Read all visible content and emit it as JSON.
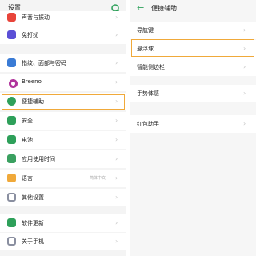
{
  "left": {
    "title": "设置",
    "items": [
      {
        "label": "声音与振动",
        "icon": "speaker-icon",
        "color": "#e8443a"
      },
      {
        "label": "免打扰",
        "icon": "moon-icon",
        "color": "#5b4fd6"
      },
      {
        "label": "指纹、面部与密码",
        "icon": "fingerprint-icon",
        "color": "#3a7bd5"
      },
      {
        "label": "Breeno",
        "icon": "breeno-icon",
        "color": "#b0349c"
      },
      {
        "label": "便捷辅助",
        "icon": "hand-icon",
        "color": "#2ea05a"
      },
      {
        "label": "安全",
        "icon": "shield-icon",
        "color": "#2ea05a"
      },
      {
        "label": "电池",
        "icon": "battery-icon",
        "color": "#2ea05a"
      },
      {
        "label": "应用使用时间",
        "icon": "clock-icon",
        "color": "#3aa060"
      },
      {
        "label": "语言",
        "icon": "language-icon",
        "color": "#f0a93a",
        "hint": "简体中文"
      },
      {
        "label": "其他设置",
        "icon": "gear-icon",
        "color": "#8a8fa0"
      },
      {
        "label": "软件更新",
        "icon": "update-icon",
        "color": "#2ea05a"
      },
      {
        "label": "关于手机",
        "icon": "info-icon",
        "color": "#8a8fa0"
      }
    ]
  },
  "right": {
    "title": "便捷辅助",
    "items": [
      {
        "label": "导航键"
      },
      {
        "label": "悬浮球"
      },
      {
        "label": "智能侧边栏"
      },
      {
        "label": "手势体感"
      },
      {
        "label": "红包助手"
      }
    ]
  }
}
